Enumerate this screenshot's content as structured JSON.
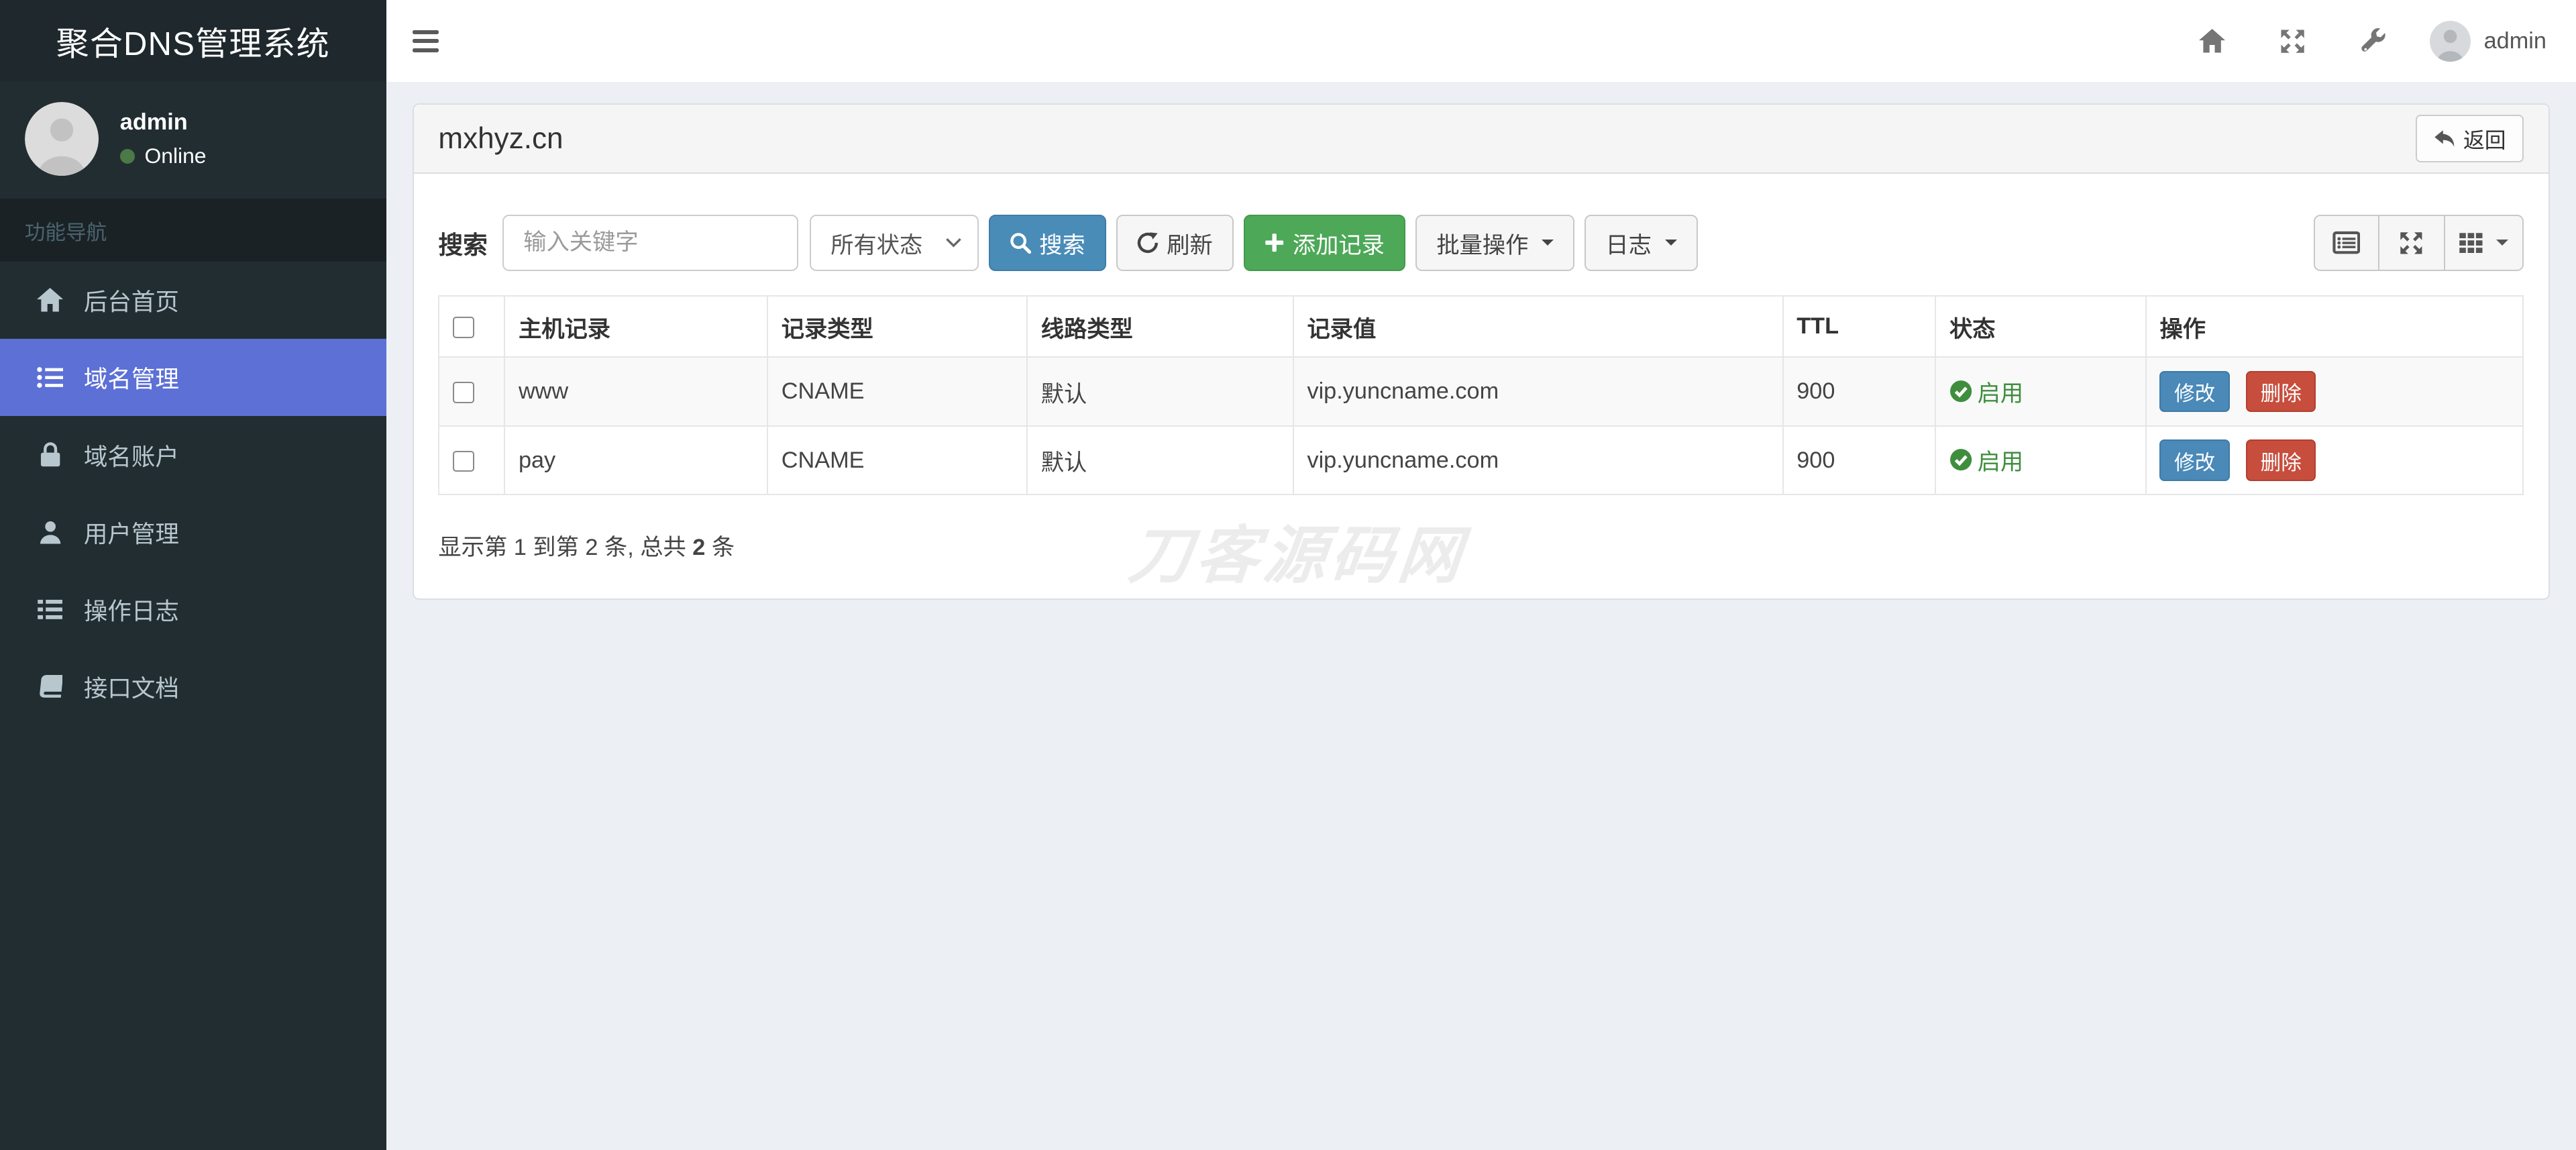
{
  "app": {
    "title": "聚合DNS管理系统"
  },
  "navbar": {
    "username": "admin"
  },
  "sidebar": {
    "user": {
      "name": "admin",
      "status": "Online"
    },
    "section_header": "功能导航",
    "items": [
      {
        "label": "后台首页"
      },
      {
        "label": "域名管理"
      },
      {
        "label": "域名账户"
      },
      {
        "label": "用户管理"
      },
      {
        "label": "操作日志"
      },
      {
        "label": "接口文档"
      }
    ]
  },
  "panel": {
    "title": "mxhyz.cn",
    "back_button": "返回",
    "toolbar": {
      "search_label": "搜索",
      "search_placeholder": "输入关键字",
      "status_filter": "所有状态",
      "search_button": "搜索",
      "refresh_button": "刷新",
      "add_button": "添加记录",
      "batch_button": "批量操作",
      "log_button": "日志"
    },
    "table": {
      "headers": [
        "主机记录",
        "记录类型",
        "线路类型",
        "记录值",
        "TTL",
        "状态",
        "操作"
      ],
      "rows": [
        {
          "host": "www",
          "type": "CNAME",
          "line": "默认",
          "value": "vip.yuncname.com",
          "ttl": "900",
          "status": "启用"
        },
        {
          "host": "pay",
          "type": "CNAME",
          "line": "默认",
          "value": "vip.yuncname.com",
          "ttl": "900",
          "status": "启用"
        }
      ],
      "edit_button": "修改",
      "delete_button": "删除"
    },
    "summary": {
      "text_before": "显示第 1 到第 2 条, 总共 ",
      "total_bold": "2",
      "text_after": " 条"
    }
  },
  "watermark": "刀客源码网",
  "colors": {
    "sidebar_bg": "#222d32",
    "sidebar_active": "#5c70d6",
    "primary_button": "#4a8cb8",
    "success_button": "#4da858",
    "edit_button": "#4a89b8",
    "delete_button": "#c74d3d",
    "status_enabled": "#3e8e3e",
    "content_bg": "#ecf0f5"
  }
}
